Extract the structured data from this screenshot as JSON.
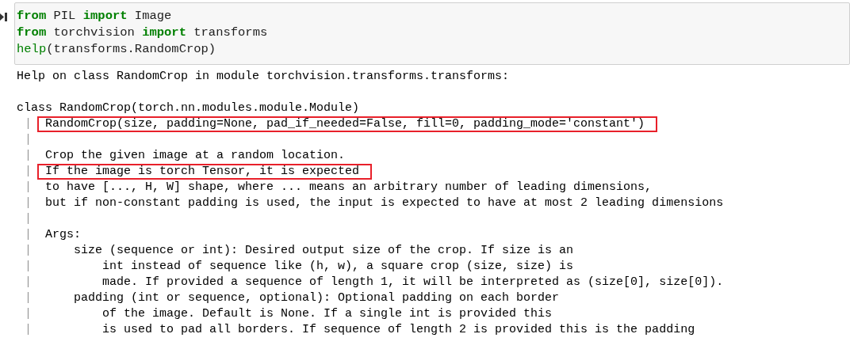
{
  "code_cell": {
    "lines": [
      [
        {
          "kind": "keyword",
          "text": "from"
        },
        {
          "kind": "plain",
          "text": " PIL "
        },
        {
          "kind": "keyword",
          "text": "import"
        },
        {
          "kind": "plain",
          "text": " Image"
        }
      ],
      [
        {
          "kind": "keyword",
          "text": "from"
        },
        {
          "kind": "plain",
          "text": " torchvision "
        },
        {
          "kind": "keyword",
          "text": "import"
        },
        {
          "kind": "plain",
          "text": " transforms"
        }
      ],
      [
        {
          "kind": "builtin",
          "text": "help"
        },
        {
          "kind": "plain",
          "text": "(transforms.RandomCrop)"
        }
      ]
    ]
  },
  "output": {
    "lines": [
      {
        "kind": "text",
        "text": "Help on class RandomCrop in module torchvision.transforms.transforms:",
        "highlighted": false
      },
      {
        "kind": "blank"
      },
      {
        "kind": "text",
        "text": "class RandomCrop(torch.nn.modules.module.Module)",
        "highlighted": false
      },
      {
        "kind": "text",
        "bar": "|",
        "text": "RandomCrop(size, padding=None, pad_if_needed=False, fill=0, padding_mode='constant')",
        "highlighted": true
      },
      {
        "kind": "blank",
        "bar": "|"
      },
      {
        "kind": "text",
        "bar": "|",
        "text": "Crop the given image at a random location.",
        "highlighted": false
      },
      {
        "kind": "text",
        "bar": "|",
        "text": "If the image is torch Tensor, it is expected",
        "highlighted": true
      },
      {
        "kind": "text",
        "bar": "|",
        "text": "to have [..., H, W] shape, where ... means an arbitrary number of leading dimensions,",
        "highlighted": false
      },
      {
        "kind": "text",
        "bar": "|",
        "text": "but if non-constant padding is used, the input is expected to have at most 2 leading dimensions",
        "highlighted": false
      },
      {
        "kind": "blank",
        "bar": "|"
      },
      {
        "kind": "text",
        "bar": "|",
        "text": "Args:",
        "highlighted": false
      },
      {
        "kind": "text",
        "bar": "|",
        "text": "    size (sequence or int): Desired output size of the crop. If size is an",
        "highlighted": false
      },
      {
        "kind": "text",
        "bar": "|",
        "text": "        int instead of sequence like (h, w), a square crop (size, size) is",
        "highlighted": false
      },
      {
        "kind": "text",
        "bar": "|",
        "text": "        made. If provided a sequence of length 1, it will be interpreted as (size[0], size[0]).",
        "highlighted": false
      },
      {
        "kind": "text",
        "bar": "|",
        "text": "    padding (int or sequence, optional): Optional padding on each border",
        "highlighted": false
      },
      {
        "kind": "text",
        "bar": "|",
        "text": "        of the image. Default is None. If a single int is provided this",
        "highlighted": false
      },
      {
        "kind": "text",
        "bar": "|",
        "text": "        is used to pad all borders. If sequence of length 2 is provided this is the padding",
        "highlighted": false
      }
    ]
  }
}
